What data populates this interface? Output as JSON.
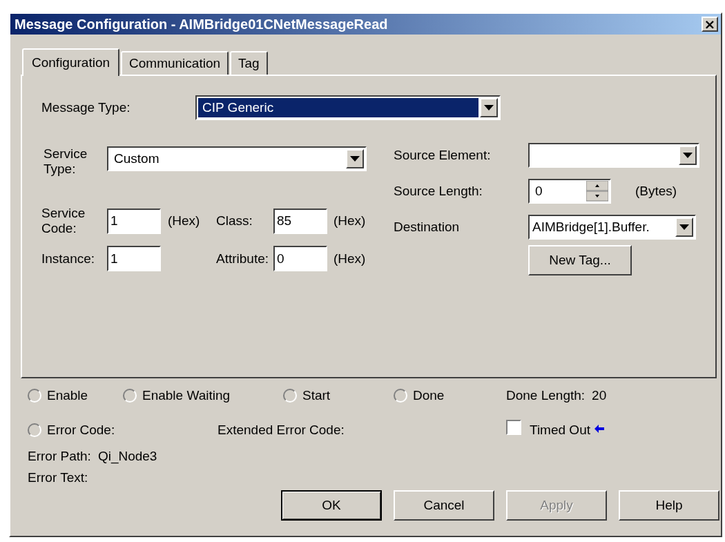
{
  "window": {
    "title": "Message Configuration - AIMBridge01CNetMessageRead",
    "close": "×"
  },
  "tabs": [
    {
      "label": "Configuration",
      "selected": true
    },
    {
      "label": "Communication",
      "selected": false
    },
    {
      "label": "Tag",
      "selected": false
    }
  ],
  "message_type": {
    "label": "Message Type:",
    "value": "CIP Generic",
    "focused": true
  },
  "service_type": {
    "label": "Service Type:",
    "value": "Custom"
  },
  "service_code": {
    "label": "Service Code:",
    "value": "1",
    "unit": "(Hex)"
  },
  "class": {
    "label": "Class:",
    "value": "85",
    "unit": "(Hex)"
  },
  "instance": {
    "label": "Instance:",
    "value": "1"
  },
  "attribute": {
    "label": "Attribute:",
    "value": "0",
    "unit": "(Hex)"
  },
  "source_element": {
    "label": "Source Element:"
  },
  "source_length": {
    "label": "Source Length:",
    "value": "0",
    "unit": "(Bytes)"
  },
  "destination": {
    "label": "Destination",
    "value": "AIMBridge[1].Buffer."
  },
  "new_tag_button": "New Tag...",
  "status": [
    {
      "label": "Enable",
      "checked": false
    },
    {
      "label": "Enable Waiting",
      "checked": false
    },
    {
      "label": "Start",
      "checked": false
    },
    {
      "label": "Done",
      "checked": false
    }
  ],
  "done_length": {
    "label": "Done Length:",
    "value": "20"
  },
  "error_code": {
    "label": "Error Code:",
    "checked": false
  },
  "extended_error_code": {
    "label": "Extended Error Code:"
  },
  "timed_out": {
    "label": "Timed Out",
    "checked": false
  },
  "error_path": {
    "label": "Error Path:",
    "value": "Qi_Node3"
  },
  "error_text": {
    "label": "Error Text:"
  },
  "buttons": [
    {
      "label": "OK",
      "disabled": false,
      "default": true
    },
    {
      "label": "Cancel",
      "disabled": false,
      "default": false
    },
    {
      "label": "Apply",
      "disabled": true,
      "default": false
    },
    {
      "label": "Help",
      "disabled": false,
      "default": false
    }
  ]
}
